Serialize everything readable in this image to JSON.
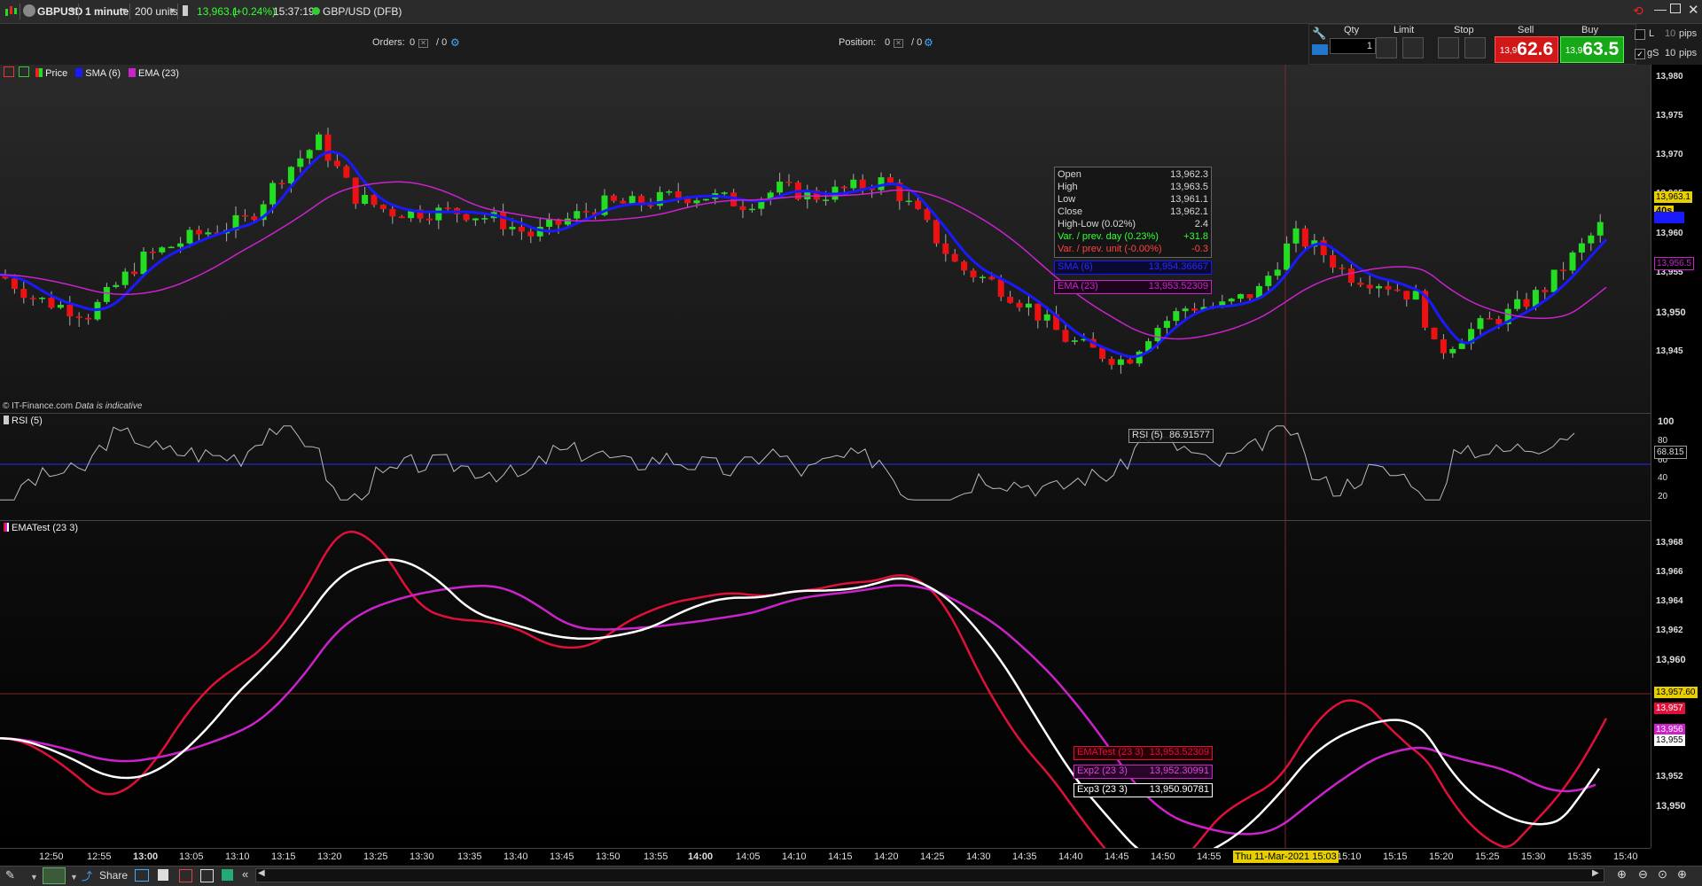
{
  "toolbar": {
    "instrument": "GBPUSD",
    "timeframe": "1 minute",
    "units": "200 units",
    "price": "13,963.1",
    "change": "(+0.24%)",
    "time": "15:37:19",
    "feed": "GBP/USD (DFB)"
  },
  "orders": {
    "orders_label": "Orders:",
    "orders_val": "0",
    "orders_slash": "/ 0",
    "position_label": "Position:",
    "position_val": "0",
    "position_slash": "/ 0"
  },
  "trade": {
    "qty_label": "Qty",
    "qty_value": "1",
    "limit_label": "Limit",
    "stop_label": "Stop",
    "sell_label": "Sell",
    "buy_label": "Buy",
    "sell_prefix": "13,9",
    "sell_big": "62.6",
    "buy_prefix": "13,9",
    "buy_big": "63.5",
    "l_label": "L",
    "l_pips": "10",
    "pips": "pips",
    "gs_label": "gS",
    "gs_pips": "10"
  },
  "price_panel": {
    "legend": [
      "Price",
      "SMA (6)",
      "EMA (23)"
    ],
    "credit": "© IT-Finance.com",
    "credit_note": "Data is indicative",
    "axis": [
      "13,980",
      "13,975",
      "13,970",
      "13,965",
      "13,960",
      "13,955",
      "13,950",
      "13,945"
    ],
    "tag_price": "13,963.1",
    "tag_timer": "40s",
    "tag_ema": "13,956.5",
    "info": [
      {
        "k": "Open",
        "v": "13,962.3"
      },
      {
        "k": "High",
        "v": "13,963.5"
      },
      {
        "k": "Low",
        "v": "13,961.1"
      },
      {
        "k": "Close",
        "v": "13,962.1"
      },
      {
        "k": "High-Low (0.02%)",
        "v": "2.4"
      },
      {
        "k": "Var. / prev. day (0.23%)",
        "v": "+31.8"
      },
      {
        "k": "Var. / prev. unit (-0.00%)",
        "v": "-0.3"
      }
    ],
    "sma_tip_k": "SMA (6)",
    "sma_tip_v": "13,954.36667",
    "ema_tip_k": "EMA (23)",
    "ema_tip_v": "13,953.52309"
  },
  "rsi_panel": {
    "legend": "RSI (5)",
    "axis": [
      "100",
      "80",
      "60",
      "40",
      "20"
    ],
    "tag": "68.815",
    "tip_k": "RSI (5)",
    "tip_v": "86.91577"
  },
  "ema_panel": {
    "legend": "EMATest (23 3)",
    "axis": [
      "13,968",
      "13,966",
      "13,964",
      "13,962",
      "13,960",
      "13,958",
      "13,956",
      "13,954",
      "13,952",
      "13,950"
    ],
    "tag_cursor": "13,957.60",
    "tag_a": "13,957",
    "tag_b": "13,956",
    "tag_c": "13,955",
    "tips": [
      {
        "k": "EMATest (23 3)",
        "v": "13,953.52309"
      },
      {
        "k": "Exp2 (23 3)",
        "v": "13,952.30991"
      },
      {
        "k": "Exp3 (23 3)",
        "v": "13,950.90781"
      }
    ]
  },
  "time_axis": [
    "12:50",
    "12:55",
    "13:00",
    "13:05",
    "13:10",
    "13:15",
    "13:20",
    "13:25",
    "13:30",
    "13:35",
    "13:40",
    "13:45",
    "13:50",
    "13:55",
    "14:00",
    "14:05",
    "14:10",
    "14:15",
    "14:20",
    "14:25",
    "14:30",
    "14:35",
    "14:40",
    "14:45",
    "14:50",
    "14:55",
    "15:10",
    "15:15",
    "15:20",
    "15:25",
    "15:30",
    "15:35",
    "15:40"
  ],
  "cursor_date": "Thu 11-Mar-2021 15:03",
  "bottom": {
    "share": "Share"
  },
  "colors": {
    "up": "#22dd22",
    "down": "#ee1111",
    "sma": "#1a1aff",
    "ema": "#cc22cc",
    "ema_red": "#e0103a",
    "ema_mag": "#cc22cc",
    "ema_white": "#ffffff"
  }
}
